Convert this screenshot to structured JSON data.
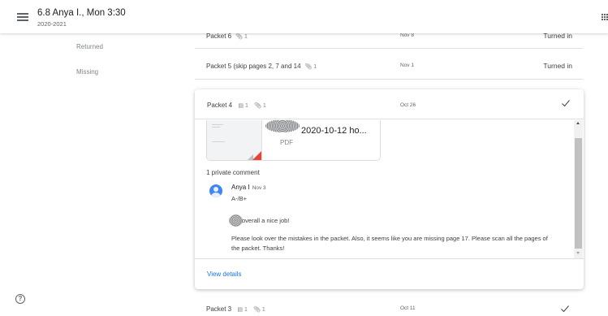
{
  "header": {
    "title": "6.8 Anya I., Mon 3:30",
    "subtitle": "2020-2021",
    "menu_icon": "menu-icon",
    "apps_icon": "apps-grid-icon"
  },
  "nav": {
    "returned": "Returned",
    "missing": "Missing",
    "help_icon": "help-icon"
  },
  "rows": [
    {
      "title": "Packet 6",
      "attach": "1",
      "date": "Nov 8",
      "status": "Turned in"
    },
    {
      "title": "Packet 5 (skip pages 2, 7 and 14",
      "attach": "1",
      "date": "Nov 1",
      "status": "Turned in"
    }
  ],
  "expanded": {
    "title": "Packet 4",
    "comments_count": "1",
    "attach": "1",
    "date": "Oct 26",
    "file": {
      "name": "2020-10-12 ho...",
      "type": "PDF"
    },
    "private_comment_label": "1 private comment",
    "comment": {
      "author": "Anya I",
      "date": "Nov 3",
      "grade": "A-/B+",
      "line1": "overall a nice job!",
      "body": "Please look over the mistakes in the packet. Also, it seems like you are missing page 17. Please scan all the pages of the packet. Thanks!"
    },
    "view_details": "View details"
  },
  "bottom_row": {
    "title": "Packet 3",
    "comments_count": "1",
    "attach": "1",
    "date": "Oct 11"
  },
  "colors": {
    "accent": "#1a73e8",
    "avatar": "#4285f4",
    "pdf_red": "#ea4335"
  }
}
